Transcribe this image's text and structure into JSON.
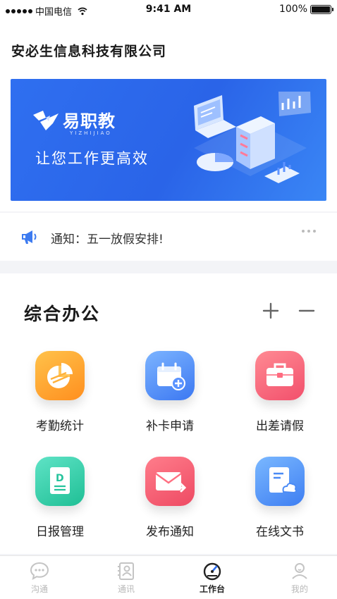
{
  "status_bar": {
    "carrier": "中国电信",
    "time": "9:41 AM",
    "battery": "100%"
  },
  "header": {
    "company_name": "安必生信息科技有限公司"
  },
  "banner": {
    "brand_name": "易职教",
    "brand_pinyin": "YIZHIJIAO",
    "slogan": "让您工作更高效",
    "color": "#2f6ff0"
  },
  "notice": {
    "text": "通知：五一放假安排!"
  },
  "office": {
    "title": "综合办公",
    "apps": [
      {
        "label": "考勤统计",
        "icon": "pie-chart-icon"
      },
      {
        "label": "补卡申请",
        "icon": "calendar-add-icon"
      },
      {
        "label": "出差请假",
        "icon": "briefcase-icon"
      },
      {
        "label": "日报管理",
        "icon": "daily-report-icon"
      },
      {
        "label": "发布通知",
        "icon": "mail-send-icon"
      },
      {
        "label": "在线文书",
        "icon": "cloud-document-icon"
      }
    ]
  },
  "tabbar": {
    "tabs": [
      {
        "label": "沟通",
        "icon": "chat-bubble-icon",
        "active": false
      },
      {
        "label": "通讯",
        "icon": "contacts-icon",
        "active": false
      },
      {
        "label": "工作台",
        "icon": "dashboard-gauge-icon",
        "active": true
      },
      {
        "label": "我的",
        "icon": "user-profile-icon",
        "active": false
      }
    ]
  }
}
